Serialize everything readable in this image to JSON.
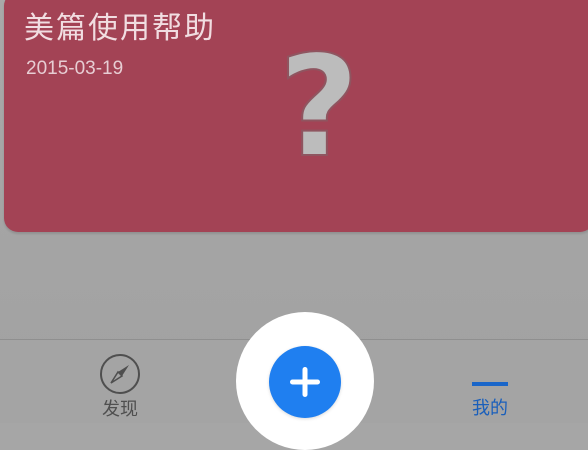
{
  "card": {
    "title": "美篇使用帮助",
    "date": "2015-03-19",
    "icon": "question-mark-icon"
  },
  "tabbar": {
    "discover_label": "发现",
    "discover_icon": "compass-icon",
    "add_icon": "plus-icon",
    "mine_label": "我的"
  },
  "colors": {
    "card_background": "#a34355",
    "overlay_gray": "#a6a6a6",
    "accent_blue": "#1f7ff0",
    "active_tab": "#1a5fbb"
  }
}
